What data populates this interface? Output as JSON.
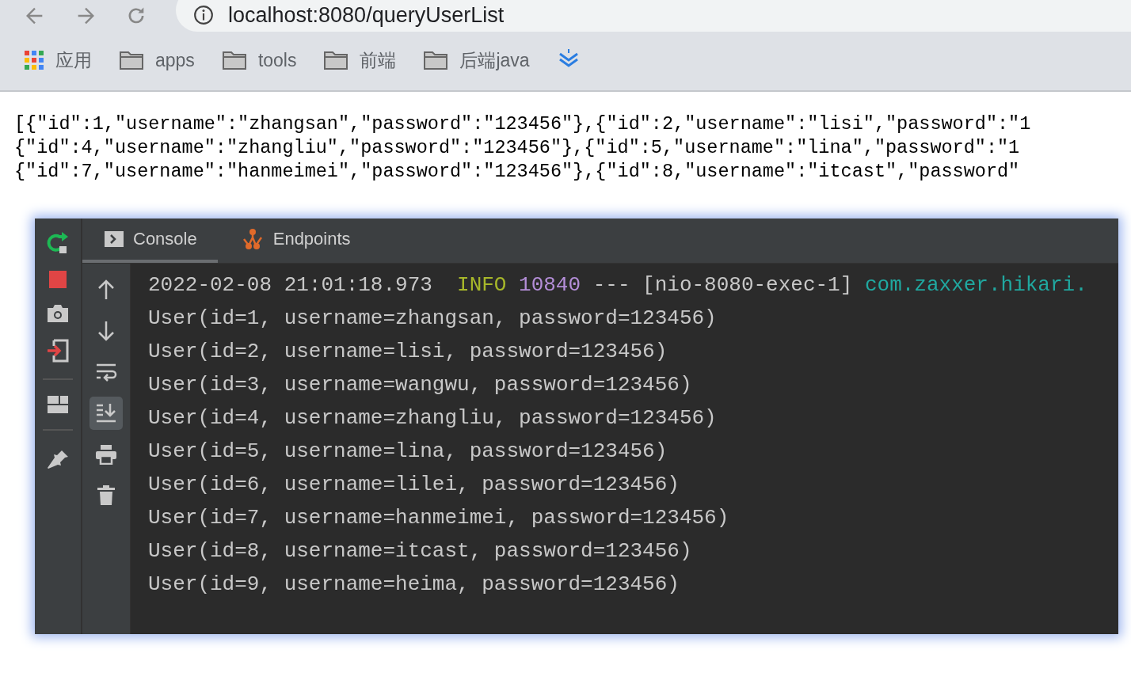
{
  "browser": {
    "url": "localhost:8080/queryUserList",
    "bookmarks": [
      {
        "kind": "apps",
        "label": "应用"
      },
      {
        "kind": "folder",
        "label": "apps"
      },
      {
        "kind": "folder",
        "label": "tools"
      },
      {
        "kind": "folder",
        "label": "前端"
      },
      {
        "kind": "folder",
        "label": "后端java"
      },
      {
        "kind": "extension"
      }
    ]
  },
  "response_lines": [
    "[{\"id\":1,\"username\":\"zhangsan\",\"password\":\"123456\"},{\"id\":2,\"username\":\"lisi\",\"password\":\"1",
    "{\"id\":4,\"username\":\"zhangliu\",\"password\":\"123456\"},{\"id\":5,\"username\":\"lina\",\"password\":\"1",
    "{\"id\":7,\"username\":\"hanmeimei\",\"password\":\"123456\"},{\"id\":8,\"username\":\"itcast\",\"password\""
  ],
  "run_panel": {
    "side_tools": [
      {
        "kind": "rerun"
      },
      {
        "kind": "stop"
      },
      {
        "kind": "camera"
      },
      {
        "kind": "exit"
      },
      {
        "kind": "divider"
      },
      {
        "kind": "layout"
      },
      {
        "kind": "divider"
      },
      {
        "kind": "pin"
      }
    ],
    "tabs": [
      {
        "kind": "console",
        "label": "Console",
        "selected": true
      },
      {
        "kind": "endpoints",
        "label": "Endpoints",
        "selected": false
      }
    ],
    "console_tools": [
      {
        "kind": "up",
        "selected": false
      },
      {
        "kind": "down",
        "selected": false
      },
      {
        "kind": "wrap",
        "selected": false
      },
      {
        "kind": "scroll-end",
        "selected": true
      },
      {
        "kind": "print",
        "selected": false
      },
      {
        "kind": "trash",
        "selected": false
      }
    ],
    "log_line": {
      "timestamp": "2022-02-08 21:01:18.973",
      "level": "INFO",
      "pid": "10840",
      "separator": "---",
      "thread": "[nio-8080-exec-1]",
      "logger": "com.zaxxer.hikari."
    },
    "output_lines": [
      "User(id=1, username=zhangsan, password=123456)",
      "User(id=2, username=lisi, password=123456)",
      "User(id=3, username=wangwu, password=123456)",
      "User(id=4, username=zhangliu, password=123456)",
      "User(id=5, username=lina, password=123456)",
      "User(id=6, username=lilei, password=123456)",
      "User(id=7, username=hanmeimei, password=123456)",
      "User(id=8, username=itcast, password=123456)",
      "User(id=9, username=heima, password=123456)"
    ]
  }
}
